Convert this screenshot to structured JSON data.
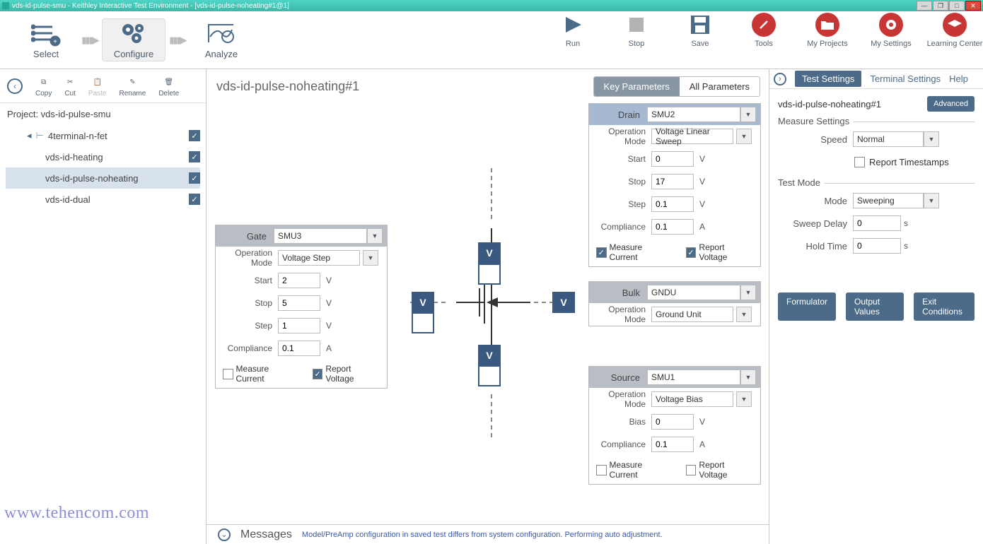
{
  "window": {
    "title": "vds-id-pulse-smu - Keithley Interactive Test Environment - [vds-id-pulse-noheating#1@1]"
  },
  "ribbon": {
    "select": "Select",
    "configure": "Configure",
    "analyze": "Analyze",
    "run": "Run",
    "stop": "Stop",
    "save": "Save",
    "tools": "Tools",
    "projects": "My Projects",
    "settings": "My Settings",
    "learning": "Learning Center"
  },
  "edit": {
    "copy": "Copy",
    "cut": "Cut",
    "paste": "Paste",
    "rename": "Rename",
    "delete": "Delete"
  },
  "project": {
    "label": "Project: vds-id-pulse-smu",
    "root": "4terminal-n-fet",
    "children": [
      "vds-id-heating",
      "vds-id-pulse-noheating",
      "vds-id-dual"
    ],
    "selectedIndex": 1
  },
  "center": {
    "title": "vds-id-pulse-noheating#1",
    "keyParams": "Key Parameters",
    "allParams": "All Parameters"
  },
  "gate": {
    "name": "Gate",
    "smu": "SMU3",
    "opModeLabel": "Operation Mode",
    "opMode": "Voltage Step",
    "startLabel": "Start",
    "start": "2",
    "stopLabel": "Stop",
    "stop": "5",
    "stepLabel": "Step",
    "step": "1",
    "complianceLabel": "Compliance",
    "compliance": "0.1",
    "unitV": "V",
    "unitA": "A",
    "measureCurrent": "Measure Current",
    "reportVoltage": "Report Voltage"
  },
  "drain": {
    "name": "Drain",
    "smu": "SMU2",
    "opModeLabel": "Operation Mode",
    "opMode": "Voltage Linear Sweep",
    "startLabel": "Start",
    "start": "0",
    "stopLabel": "Stop",
    "stop": "17",
    "stepLabel": "Step",
    "step": "0.1",
    "complianceLabel": "Compliance",
    "compliance": "0.1",
    "unitV": "V",
    "unitA": "A",
    "measureCurrent": "Measure Current",
    "reportVoltage": "Report Voltage"
  },
  "bulk": {
    "name": "Bulk",
    "smu": "GNDU",
    "opModeLabel": "Operation Mode",
    "opMode": "Ground Unit"
  },
  "source": {
    "name": "Source",
    "smu": "SMU1",
    "opModeLabel": "Operation Mode",
    "opMode": "Voltage Bias",
    "biasLabel": "Bias",
    "bias": "0",
    "complianceLabel": "Compliance",
    "compliance": "0.1",
    "unitV": "V",
    "unitA": "A",
    "measureCurrent": "Measure Current",
    "reportVoltage": "Report Voltage"
  },
  "right": {
    "testSettings": "Test Settings",
    "terminalSettings": "Terminal Settings",
    "help": "Help",
    "title": "vds-id-pulse-noheating#1",
    "advanced": "Advanced",
    "measureSettings": "Measure Settings",
    "speedLabel": "Speed",
    "speed": "Normal",
    "reportTs": "Report Timestamps",
    "testMode": "Test Mode",
    "modeLabel": "Mode",
    "mode": "Sweeping",
    "sweepDelayLabel": "Sweep Delay",
    "sweepDelay": "0",
    "holdTimeLabel": "Hold Time",
    "holdTime": "0",
    "unitS": "s",
    "formulator": "Formulator",
    "outputValues": "Output Values",
    "exitConditions": "Exit Conditions"
  },
  "messages": {
    "label": "Messages",
    "text": "Model/PreAmp configuration in saved test differs from system configuration. Performing auto adjustment."
  },
  "watermark": "www.tehencom.com"
}
